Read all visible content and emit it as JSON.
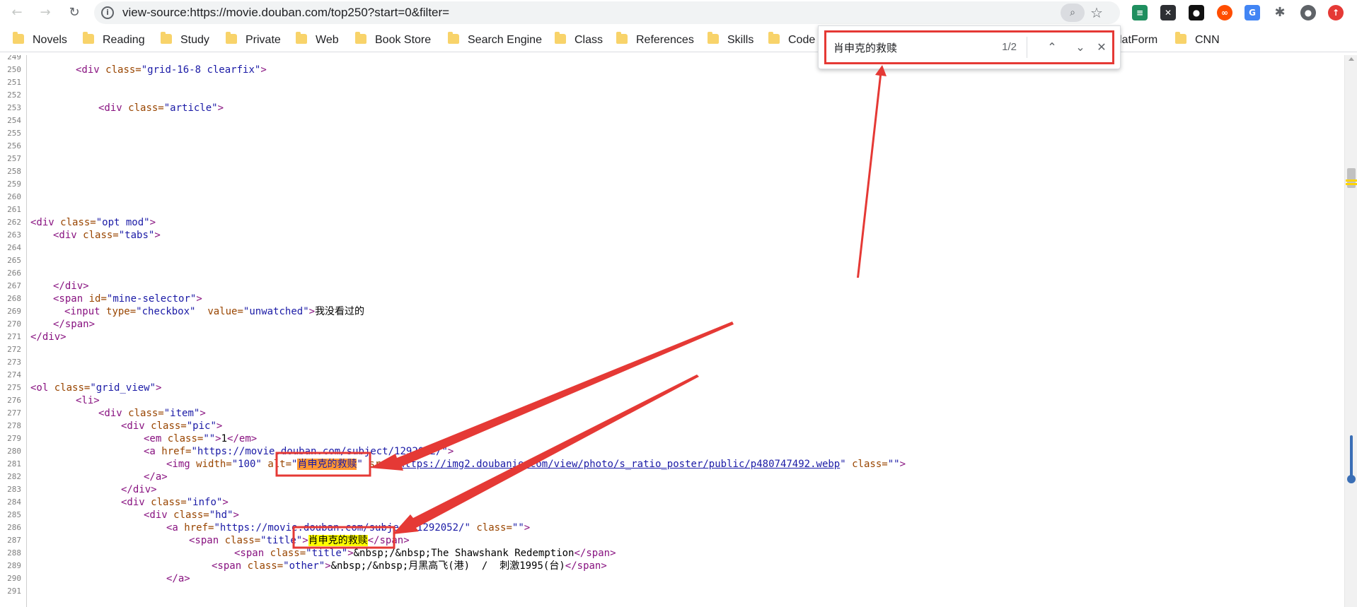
{
  "browser": {
    "url": "view-source:https://movie.douban.com/top250?start=0&filter=",
    "nav_back_icon": "←",
    "nav_forward_icon": "→",
    "reload_icon": "↻",
    "star_icon": "☆"
  },
  "bookmarks": [
    "Novels",
    "Reading",
    "Study",
    "Private",
    "Web",
    "Book Store",
    "Search Engine",
    "Class",
    "References",
    "Skills",
    "Code",
    "latForm",
    "CNN"
  ],
  "find_bar": {
    "query": "肖申克的救赎",
    "count": "1/2",
    "prev_icon": "⌃",
    "next_icon": "⌄",
    "close_icon": "✕"
  },
  "source_lines": {
    "n249": "249",
    "n250": "250",
    "n251": "251",
    "n252": "252",
    "n253": "253",
    "n254": "254",
    "n255": "255",
    "n256": "256",
    "n257": "257",
    "n258": "258",
    "n259": "259",
    "n260": "260",
    "n261": "261",
    "n262": "262",
    "n263": "263",
    "n264": "264",
    "n265": "265",
    "n266": "266",
    "n267": "267",
    "n268": "268",
    "n269": "269",
    "n270": "270",
    "n271": "271",
    "n272": "272",
    "n273": "273",
    "n274": "274",
    "n275": "275",
    "n276": "276",
    "n277": "277",
    "n278": "278",
    "n279": "279",
    "n280": "280",
    "n281": "281",
    "n282": "282",
    "n283": "283",
    "n284": "284",
    "n285": "285",
    "n286": "286",
    "n287": "287",
    "n288": "288",
    "n289": "289",
    "n290": "290",
    "n291": "291"
  },
  "code": {
    "div_open": "<div",
    "div_close": "</div>",
    "span_open": "<span",
    "span_close": "</span>",
    "ol_open": "<ol",
    "li_open": "<li>",
    "em_open": "<em",
    "em_close": "</em>",
    "a_open": "<a",
    "a_close": "</a>",
    "img_open": "<img",
    "input_open": "<input",
    "gt": ">",
    "attr_class": "class=",
    "attr_id": "id=",
    "attr_type": "type=",
    "attr_value": "value=",
    "attr_href": "href=",
    "attr_width": "width=",
    "attr_alt": "alt=",
    "attr_src": "src=",
    "v_grid": "\"grid-16-8 clearfix\"",
    "v_article": "\"article\"",
    "v_opt": "\"opt mod\"",
    "v_tabs": "\"tabs\"",
    "v_mine": "\"mine-selector\"",
    "v_checkbox": "\"checkbox\"",
    "v_unwatched": "\"unwatched\"",
    "t_unwatched": "我没看过的",
    "v_gridview": "\"grid_view\"",
    "v_item": "\"item\"",
    "v_pic": "\"pic\"",
    "v_empty": "\"\"",
    "t_rank": "1",
    "v_href_open": "\"",
    "href_url": "https://movie.douban.com/subject/1292052/",
    "v_href_close": "\"",
    "v_100": "\"100\"",
    "match_title": "肖申克的救赎",
    "q": "\"",
    "img_src": "https://img2.doubanio.com/view/photo/s_ratio_poster/public/p480747492.webp",
    "v_info": "\"info\"",
    "v_hd": "\"hd\"",
    "v_title": "\"title\"",
    "v_other": "\"other\"",
    "t_en_title": "&nbsp;/&nbsp;The Shawshank Redemption",
    "t_other": "&nbsp;/&nbsp;月黑高飞(港)  /  刺激1995(台)"
  },
  "colors": {
    "tag": "#881280",
    "attr_name": "#994500",
    "attr_value": "#1a1aa6",
    "current_match": "#ff9632",
    "other_match": "#ffff00",
    "annotation_red": "#e53935"
  }
}
